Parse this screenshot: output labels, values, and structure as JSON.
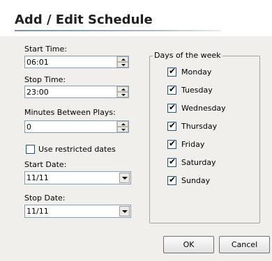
{
  "dialog": {
    "title": "Add / Edit Schedule"
  },
  "left": {
    "start_time": {
      "label": "Start Time:",
      "value": "06:01"
    },
    "stop_time": {
      "label": "Stop Time:",
      "value": "23:00"
    },
    "minutes_between": {
      "label": "Minutes Between Plays:",
      "value": "0"
    },
    "restricted": {
      "label": "Use restricted dates",
      "checked": false
    },
    "start_date": {
      "label": "Start Date:",
      "value": "11/11"
    },
    "stop_date": {
      "label": "Stop Date:",
      "value": "11/11"
    }
  },
  "days": {
    "legend": "Days of the week",
    "items": [
      {
        "label": "Monday",
        "checked": true
      },
      {
        "label": "Tuesday",
        "checked": true
      },
      {
        "label": "Wednesday",
        "checked": true
      },
      {
        "label": "Thursday",
        "checked": true
      },
      {
        "label": "Friday",
        "checked": true
      },
      {
        "label": "Saturday",
        "checked": true
      },
      {
        "label": "Sunday",
        "checked": true
      }
    ]
  },
  "buttons": {
    "ok": "OK",
    "cancel": "Cancel"
  },
  "check_mark": "✔"
}
